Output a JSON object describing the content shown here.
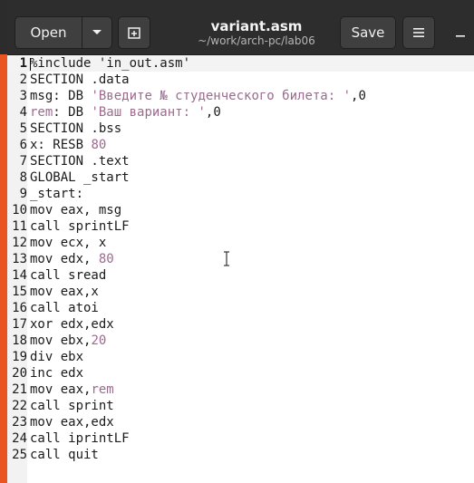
{
  "window": {
    "title": "variant.asm",
    "subtitle": "~/work/arch-pc/lab06"
  },
  "headerbar": {
    "open_label": "Open",
    "open_dropdown_icon": "chevron-down-icon",
    "new_tab_icon": "new-tab-icon",
    "save_label": "Save",
    "menu_icon": "hamburger-menu-icon",
    "minimize_icon": "minimize-icon"
  },
  "colors": {
    "accent_strip": "#e95420",
    "headerbar_bg": "#2d2d2d",
    "string_color": "#9b6b8e"
  },
  "editor": {
    "current_line": 1,
    "lines": [
      {
        "n": "1",
        "parts": [
          {
            "t": "%include ",
            "c": "kw"
          },
          {
            "t": "'in_out.asm'",
            "c": "plain"
          }
        ]
      },
      {
        "n": "2",
        "parts": [
          {
            "t": "SECTION .data",
            "c": "plain"
          }
        ]
      },
      {
        "n": "3",
        "parts": [
          {
            "t": "msg: DB ",
            "c": "plain"
          },
          {
            "t": "'Введите № студенческого билета: '",
            "c": "str"
          },
          {
            "t": ",0",
            "c": "plain"
          }
        ]
      },
      {
        "n": "4",
        "parts": [
          {
            "t": "rem",
            "c": "str"
          },
          {
            "t": ": DB ",
            "c": "plain"
          },
          {
            "t": "'Ваш вариант: '",
            "c": "str"
          },
          {
            "t": ",0",
            "c": "plain"
          }
        ]
      },
      {
        "n": "5",
        "parts": [
          {
            "t": "SECTION .bss",
            "c": "plain"
          }
        ]
      },
      {
        "n": "6",
        "parts": [
          {
            "t": "x: RESB ",
            "c": "plain"
          },
          {
            "t": "80",
            "c": "num"
          }
        ]
      },
      {
        "n": "7",
        "parts": [
          {
            "t": "SECTION .text",
            "c": "plain"
          }
        ]
      },
      {
        "n": "8",
        "parts": [
          {
            "t": "GLOBAL _start",
            "c": "plain"
          }
        ]
      },
      {
        "n": "9",
        "parts": [
          {
            "t": "_start:",
            "c": "plain"
          }
        ]
      },
      {
        "n": "10",
        "parts": [
          {
            "t": "mov eax, msg",
            "c": "plain"
          }
        ]
      },
      {
        "n": "11",
        "parts": [
          {
            "t": "call sprintLF",
            "c": "plain"
          }
        ]
      },
      {
        "n": "12",
        "parts": [
          {
            "t": "mov ecx, x",
            "c": "plain"
          }
        ]
      },
      {
        "n": "13",
        "parts": [
          {
            "t": "mov edx, ",
            "c": "plain"
          },
          {
            "t": "80",
            "c": "num"
          }
        ]
      },
      {
        "n": "14",
        "parts": [
          {
            "t": "call sread",
            "c": "plain"
          }
        ]
      },
      {
        "n": "15",
        "parts": [
          {
            "t": "mov eax,x",
            "c": "plain"
          }
        ]
      },
      {
        "n": "16",
        "parts": [
          {
            "t": "call atoi",
            "c": "plain"
          }
        ]
      },
      {
        "n": "17",
        "parts": [
          {
            "t": "xor edx,edx",
            "c": "plain"
          }
        ]
      },
      {
        "n": "18",
        "parts": [
          {
            "t": "mov ebx,",
            "c": "plain"
          },
          {
            "t": "20",
            "c": "num"
          }
        ]
      },
      {
        "n": "19",
        "parts": [
          {
            "t": "div ebx",
            "c": "plain"
          }
        ]
      },
      {
        "n": "20",
        "parts": [
          {
            "t": "inc edx",
            "c": "plain"
          }
        ]
      },
      {
        "n": "21",
        "parts": [
          {
            "t": "mov eax,",
            "c": "plain"
          },
          {
            "t": "rem",
            "c": "str"
          }
        ]
      },
      {
        "n": "22",
        "parts": [
          {
            "t": "call sprint",
            "c": "plain"
          }
        ]
      },
      {
        "n": "23",
        "parts": [
          {
            "t": "mov eax,edx",
            "c": "plain"
          }
        ]
      },
      {
        "n": "24",
        "parts": [
          {
            "t": "call iprintLF",
            "c": "plain"
          }
        ]
      },
      {
        "n": "25",
        "parts": [
          {
            "t": "call quit",
            "c": "plain"
          }
        ]
      }
    ]
  }
}
